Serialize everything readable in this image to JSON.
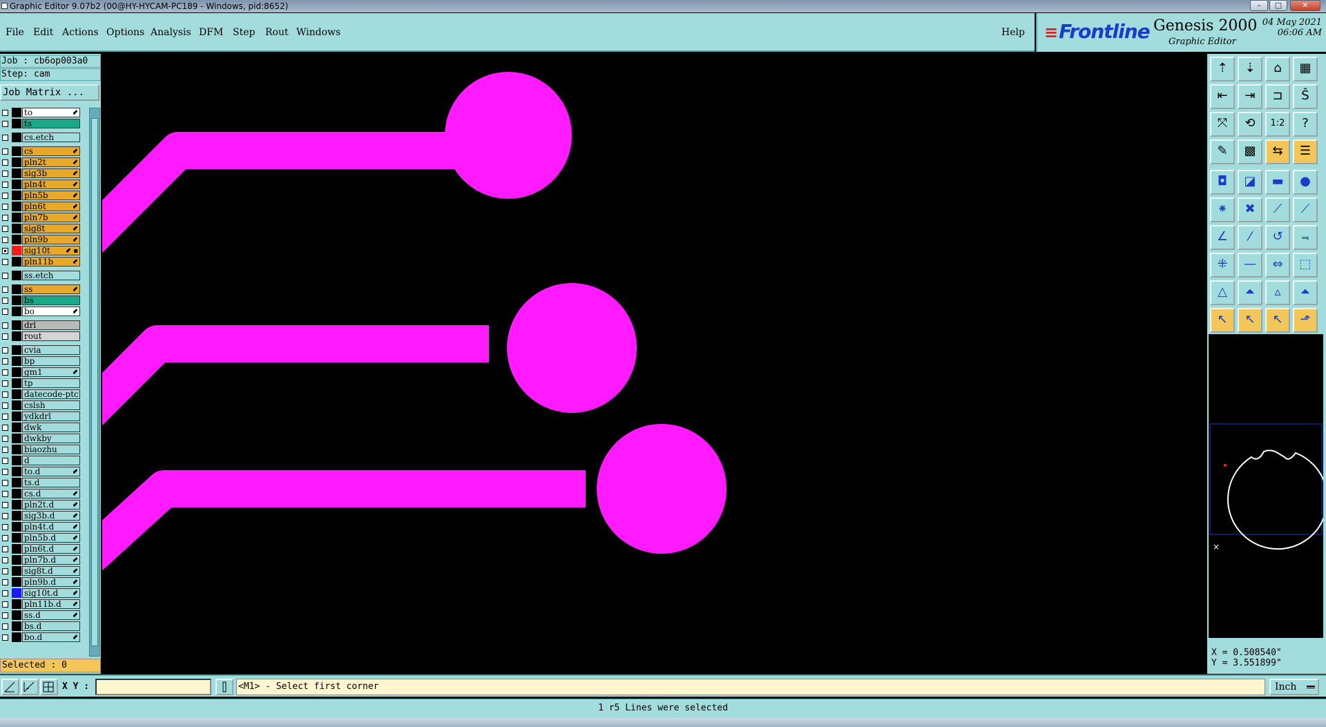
{
  "window": {
    "title": "Graphic Editor 9.07b2 (00@HY-HYCAM-PC189 - Windows, pid:8652)",
    "minimize": "–",
    "maximize": "□",
    "close": "✕"
  },
  "menu": {
    "items": [
      "File",
      "Edit",
      "Actions",
      "Options",
      "Analysis",
      "DFM",
      "Step",
      "Rout",
      "Windows"
    ],
    "help": "Help"
  },
  "brand": {
    "logo": "Frontline",
    "product": "Genesis 2000",
    "subtitle": "Graphic Editor",
    "date": "04 May 2021",
    "time": "06:06 AM"
  },
  "job": {
    "job_line": "Job : cb6op003a0",
    "step_line": "Step: cam",
    "matrix_button": "Job Matrix ..."
  },
  "layers": [
    {
      "name": "to",
      "color": "#ffffff",
      "mark": "⬋"
    },
    {
      "name": "ts",
      "color": "#1aa888",
      "mark": ""
    },
    {
      "name": "cs.etch",
      "color": "#a3dcdc",
      "mark": "",
      "gap": true
    },
    {
      "name": "cs",
      "color": "#e8a92a",
      "mark": "⬋",
      "gap": true
    },
    {
      "name": "pln2t",
      "color": "#e8a92a",
      "mark": "⬋"
    },
    {
      "name": "sig3b",
      "color": "#e8a92a",
      "mark": "⬋"
    },
    {
      "name": "pln4t",
      "color": "#e8a92a",
      "mark": "⬋"
    },
    {
      "name": "pln5b",
      "color": "#e8a92a",
      "mark": "⬋"
    },
    {
      "name": "pln6t",
      "color": "#e8a92a",
      "mark": "⬋"
    },
    {
      "name": "pln7b",
      "color": "#e8a92a",
      "mark": "⬋"
    },
    {
      "name": "sig8t",
      "color": "#e8a92a",
      "mark": "⬋"
    },
    {
      "name": "pln9b",
      "color": "#e8a92a",
      "mark": "⬋"
    },
    {
      "name": "sig10t",
      "color": "#e8a92a",
      "mark": "⬋ ▪",
      "swatch": "#ff1a1a",
      "checked": true
    },
    {
      "name": "pln11b",
      "color": "#e8a92a",
      "mark": "⬋"
    },
    {
      "name": "ss.etch",
      "color": "#a3dcdc",
      "mark": "",
      "gap": true
    },
    {
      "name": "ss",
      "color": "#e8a92a",
      "mark": "⬋",
      "gap": true
    },
    {
      "name": "bs",
      "color": "#1aa888",
      "mark": ""
    },
    {
      "name": "bo",
      "color": "#ffffff",
      "mark": "⬋"
    },
    {
      "name": "drl",
      "color": "#b8b8b8",
      "mark": "",
      "gap": true
    },
    {
      "name": "rout",
      "color": "#d4d4d4",
      "mark": ""
    },
    {
      "name": "cvia",
      "color": "#a3dcdc",
      "mark": "",
      "gap": true
    },
    {
      "name": "bp",
      "color": "#a3dcdc",
      "mark": ""
    },
    {
      "name": "gm1",
      "color": "#a3dcdc",
      "mark": "⬋"
    },
    {
      "name": "tp",
      "color": "#a3dcdc",
      "mark": ""
    },
    {
      "name": "datecode-ptc",
      "color": "#a3dcdc",
      "mark": ""
    },
    {
      "name": "cslsh",
      "color": "#a3dcdc",
      "mark": ""
    },
    {
      "name": "ydkdrl",
      "color": "#a3dcdc",
      "mark": ""
    },
    {
      "name": "dwk",
      "color": "#a3dcdc",
      "mark": ""
    },
    {
      "name": "dwkby",
      "color": "#a3dcdc",
      "mark": ""
    },
    {
      "name": "biaozhu",
      "color": "#a3dcdc",
      "mark": ""
    },
    {
      "name": "d",
      "color": "#a3dcdc",
      "mark": ""
    },
    {
      "name": "to.d",
      "color": "#a3dcdc",
      "mark": "⬋"
    },
    {
      "name": "ts.d",
      "color": "#a3dcdc",
      "mark": ""
    },
    {
      "name": "cs.d",
      "color": "#a3dcdc",
      "mark": "⬋"
    },
    {
      "name": "pln2t.d",
      "color": "#a3dcdc",
      "mark": "⬋"
    },
    {
      "name": "sig3b.d",
      "color": "#a3dcdc",
      "mark": "⬋"
    },
    {
      "name": "pln4t.d",
      "color": "#a3dcdc",
      "mark": "⬋"
    },
    {
      "name": "pln5b.d",
      "color": "#a3dcdc",
      "mark": "⬋"
    },
    {
      "name": "pln6t.d",
      "color": "#a3dcdc",
      "mark": "⬋"
    },
    {
      "name": "pln7b.d",
      "color": "#a3dcdc",
      "mark": "⬋"
    },
    {
      "name": "sig8t.d",
      "color": "#a3dcdc",
      "mark": "⬋"
    },
    {
      "name": "pln9b.d",
      "color": "#a3dcdc",
      "mark": "⬋"
    },
    {
      "name": "sig10t.d",
      "color": "#a3dcdc",
      "mark": "⬋",
      "swatch": "#1a1aff"
    },
    {
      "name": "pln11b.d",
      "color": "#a3dcdc",
      "mark": "⬋"
    },
    {
      "name": "ss.d",
      "color": "#a3dcdc",
      "mark": "⬋"
    },
    {
      "name": "bs.d",
      "color": "#a3dcdc",
      "mark": ""
    },
    {
      "name": "bo.d",
      "color": "#a3dcdc",
      "mark": "⬋"
    }
  ],
  "selected_count": "Selected : 0",
  "canvas": {
    "trace_color": "#ff1aff"
  },
  "toolbar": {
    "icons": [
      "open-step-icon",
      "save-icon",
      "home-icon",
      "panel-icon",
      "undo-icon",
      "redo-icon",
      "mirror-icon",
      "snap-icon",
      "zoom-fit-icon",
      "zoom-home-icon",
      "scale-1-2-icon",
      "help-query-icon",
      "measure-icon",
      "grid-icon",
      "layer-compare-icon",
      "layer-list-icon",
      "feature-filter-icon",
      "select-window-icon",
      "ruler-icon",
      "pad-icon",
      "add-pad-icon",
      "cross-icon",
      "add-line-icon",
      "move-node-icon",
      "angle-icon",
      "slash-icon",
      "arc-icon",
      "text-f-icon",
      "snap-pad-icon",
      "dash-line-icon",
      "move-icon",
      "shapes-icon",
      "triangle-add-icon",
      "triangle-edit-icon",
      "triangle-a-icon",
      "triangle-cut-icon",
      "pointer-icon",
      "pointer-box-icon",
      "pointer-orange-icon",
      "route-pointer-icon"
    ],
    "scale_label": "1:2"
  },
  "coords": {
    "x": "X = 0.508540\"",
    "y": "Y = 3.551899\""
  },
  "statusbar": {
    "xy_label": "X Y :",
    "prompt": "<M1> - Select first corner",
    "unit": "Inch",
    "message": "1 r5 Lines were selected"
  }
}
